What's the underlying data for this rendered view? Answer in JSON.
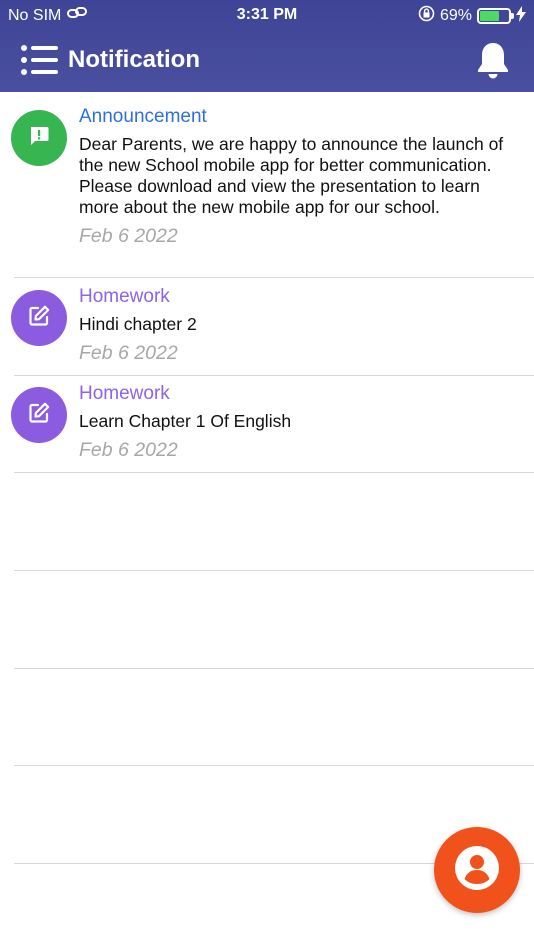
{
  "status_bar": {
    "carrier": "No SIM",
    "time": "3:31 PM",
    "battery_percent": "69%",
    "battery_level": 0.69
  },
  "appbar": {
    "title": "Notification",
    "menu_icon": "menu-list-icon",
    "bell_icon": "bell-icon"
  },
  "colors": {
    "header": "#4a4f9f",
    "announcement": "#36b550",
    "homework": "#8b5be0",
    "announcement_text": "#2f6fd9",
    "homework_text": "#8f62e6",
    "fab": "#f1511a"
  },
  "notifications": [
    {
      "category": "Announcement",
      "icon": "alert-message-icon",
      "message": "Dear Parents, we are happy to announce the launch of the new School mobile app for better communication. Please download and view the presentation to learn more about the new mobile app for our school.",
      "date": "Feb  6 2022"
    },
    {
      "category": "Homework",
      "icon": "edit-icon",
      "message": "Hindi chapter 2",
      "date": "Feb  6 2022"
    },
    {
      "category": "Homework",
      "icon": "edit-icon",
      "message": "Learn Chapter 1 Of English",
      "date": "Feb  6 2022"
    }
  ],
  "fab": {
    "icon": "user-profile-icon"
  }
}
